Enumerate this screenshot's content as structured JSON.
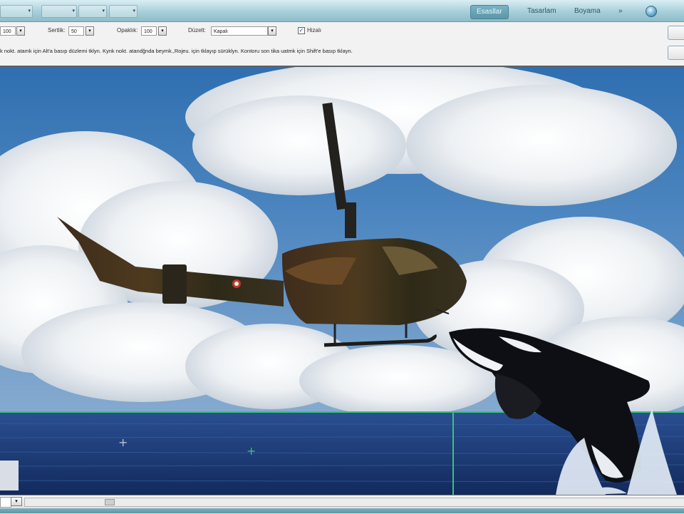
{
  "toolbar": {
    "tools": [
      {
        "name": "selection-tool",
        "label": ""
      },
      {
        "name": "zoom-tool",
        "label": ""
      },
      {
        "name": "view-extras",
        "label": ""
      },
      {
        "name": "screen-mode",
        "label": ""
      }
    ],
    "workspace_tabs": [
      {
        "label": "Esasllar",
        "active": true
      },
      {
        "label": "Tasarlam",
        "active": false
      },
      {
        "label": "Boyama",
        "active": false
      },
      {
        "label": "»",
        "active": false
      }
    ],
    "globe_icon": "globe-icon"
  },
  "options": {
    "size_value": "100",
    "hardness_label": "Sertlik:",
    "hardness_value": "50",
    "opacity_label": "Opaklık:",
    "opacity_value": "100",
    "mode_label": "Düzelt:",
    "mode_value": "Kapalı",
    "aligned_label": "Hizalı",
    "aligned_checked": true,
    "hint_text": "k nokt. atamk için Alt'a basıp düzlemi tklyn. Kynk nokt. atandğnda beymk.,Rojeu. için tklayıp sürüklyn. Kontoru son tika uatmk için Shift'e basıp tklayn."
  },
  "canvas": {
    "image": "helicopter-and-orca-photo",
    "sky_color": "#4a82be",
    "sea_color": "#1f3f7a",
    "selection_color": "#3fbf7a"
  },
  "statusbar": {
    "zoom_value": "",
    "dropdown_icon": "chevron-down-icon"
  }
}
